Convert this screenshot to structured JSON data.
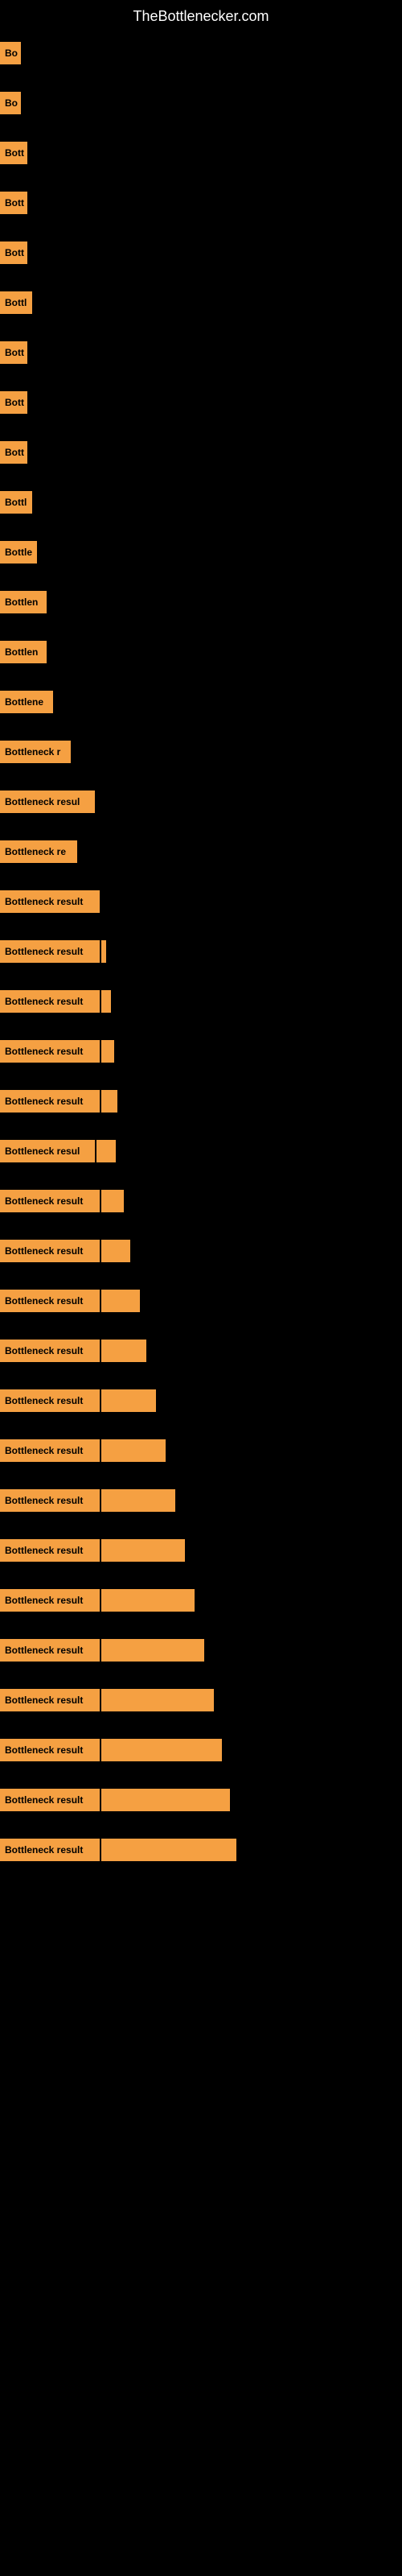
{
  "title": "TheBottlenecker.com",
  "rows": [
    {
      "label": "Bo",
      "barWidth": 0,
      "labelWidth": 26
    },
    {
      "label": "Bo",
      "barWidth": 0,
      "labelWidth": 26
    },
    {
      "label": "Bott",
      "barWidth": 0,
      "labelWidth": 34
    },
    {
      "label": "Bott",
      "barWidth": 0,
      "labelWidth": 34
    },
    {
      "label": "Bott",
      "barWidth": 0,
      "labelWidth": 34
    },
    {
      "label": "Bottl",
      "barWidth": 0,
      "labelWidth": 40
    },
    {
      "label": "Bott",
      "barWidth": 0,
      "labelWidth": 34
    },
    {
      "label": "Bott",
      "barWidth": 0,
      "labelWidth": 34
    },
    {
      "label": "Bott",
      "barWidth": 0,
      "labelWidth": 34
    },
    {
      "label": "Bottl",
      "barWidth": 0,
      "labelWidth": 40
    },
    {
      "label": "Bottle",
      "barWidth": 0,
      "labelWidth": 46
    },
    {
      "label": "Bottlen",
      "barWidth": 0,
      "labelWidth": 58
    },
    {
      "label": "Bottlen",
      "barWidth": 0,
      "labelWidth": 58
    },
    {
      "label": "Bottlene",
      "barWidth": 0,
      "labelWidth": 66
    },
    {
      "label": "Bottleneck r",
      "barWidth": 0,
      "labelWidth": 88
    },
    {
      "label": "Bottleneck resul",
      "barWidth": 0,
      "labelWidth": 118
    },
    {
      "label": "Bottleneck re",
      "barWidth": 0,
      "labelWidth": 96
    },
    {
      "label": "Bottleneck result",
      "barWidth": 0,
      "labelWidth": 124
    },
    {
      "label": "Bottleneck result",
      "barWidth": 6,
      "labelWidth": 124
    },
    {
      "label": "Bottleneck result",
      "barWidth": 12,
      "labelWidth": 124
    },
    {
      "label": "Bottleneck result",
      "barWidth": 16,
      "labelWidth": 124
    },
    {
      "label": "Bottleneck result",
      "barWidth": 20,
      "labelWidth": 124
    },
    {
      "label": "Bottleneck resul",
      "barWidth": 24,
      "labelWidth": 118
    },
    {
      "label": "Bottleneck result",
      "barWidth": 28,
      "labelWidth": 124
    },
    {
      "label": "Bottleneck result",
      "barWidth": 36,
      "labelWidth": 124
    },
    {
      "label": "Bottleneck result",
      "barWidth": 48,
      "labelWidth": 124
    },
    {
      "label": "Bottleneck result",
      "barWidth": 56,
      "labelWidth": 124
    },
    {
      "label": "Bottleneck result",
      "barWidth": 68,
      "labelWidth": 124
    },
    {
      "label": "Bottleneck result",
      "barWidth": 80,
      "labelWidth": 124
    },
    {
      "label": "Bottleneck result",
      "barWidth": 92,
      "labelWidth": 124
    },
    {
      "label": "Bottleneck result",
      "barWidth": 104,
      "labelWidth": 124
    },
    {
      "label": "Bottleneck result",
      "barWidth": 116,
      "labelWidth": 124
    },
    {
      "label": "Bottleneck result",
      "barWidth": 128,
      "labelWidth": 124
    },
    {
      "label": "Bottleneck result",
      "barWidth": 140,
      "labelWidth": 124
    },
    {
      "label": "Bottleneck result",
      "barWidth": 150,
      "labelWidth": 124
    },
    {
      "label": "Bottleneck result",
      "barWidth": 160,
      "labelWidth": 124
    },
    {
      "label": "Bottleneck result",
      "barWidth": 168,
      "labelWidth": 124
    }
  ]
}
